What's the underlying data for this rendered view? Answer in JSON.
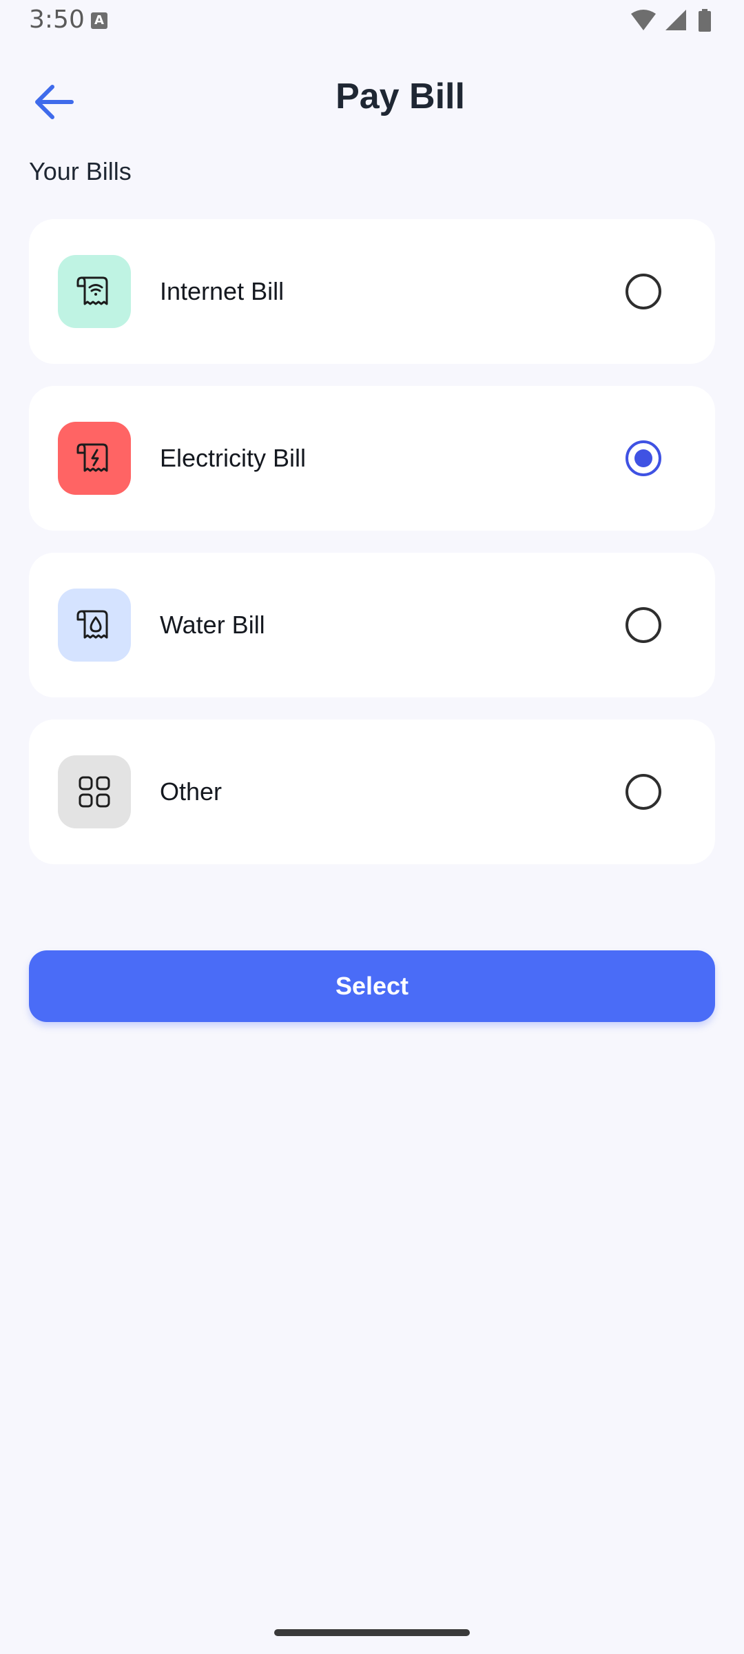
{
  "status_bar": {
    "time": "3:50",
    "notification_icon": "A",
    "icons": [
      "wifi-icon",
      "signal-icon",
      "battery-icon"
    ]
  },
  "header": {
    "title": "Pay Bill",
    "back_icon": "arrow-left-icon"
  },
  "section": {
    "title": "Your Bills"
  },
  "bills": [
    {
      "label": "Internet Bill",
      "icon": "wifi-receipt-icon",
      "icon_bg": "#BFF3E3",
      "selected": false
    },
    {
      "label": "Electricity Bill",
      "icon": "lightning-receipt-icon",
      "icon_bg": "#FF6464",
      "selected": true
    },
    {
      "label": "Water Bill",
      "icon": "water-drop-receipt-icon",
      "icon_bg": "#D5E3FF",
      "selected": false
    },
    {
      "label": "Other",
      "icon": "grid-icon",
      "icon_bg": "#E3E3E3",
      "selected": false
    }
  ],
  "actions": {
    "select_label": "Select"
  },
  "colors": {
    "accent": "#4A6CF7",
    "radio_selected": "#3F52E3",
    "background": "#F7F7FD",
    "card": "#FFFFFF"
  }
}
